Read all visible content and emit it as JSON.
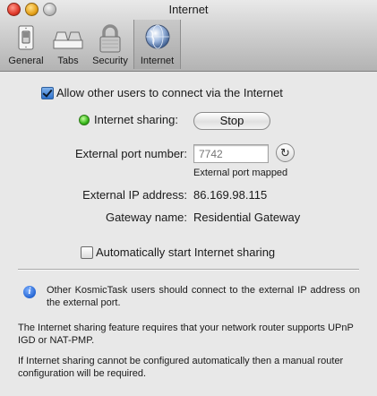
{
  "window": {
    "title": "Internet"
  },
  "toolbar": {
    "items": [
      {
        "label": "General",
        "icon": "light-switch-icon",
        "selected": false
      },
      {
        "label": "Tabs",
        "icon": "tabs-icon",
        "selected": false
      },
      {
        "label": "Security",
        "icon": "padlock-icon",
        "selected": false
      },
      {
        "label": "Internet",
        "icon": "globe-icon",
        "selected": true
      }
    ]
  },
  "settings": {
    "allow_checkbox": {
      "label": "Allow other users to connect via the Internet",
      "checked": true
    },
    "sharing": {
      "label": "Internet sharing:",
      "status_color": "#36b81a",
      "button_label": "Stop"
    },
    "port": {
      "label": "External port number:",
      "placeholder": "7742",
      "status": "External port mapped"
    },
    "ip": {
      "label": "External IP address:",
      "value": "86.169.98.115"
    },
    "gateway": {
      "label": "Gateway name:",
      "value": "Residential Gateway"
    },
    "auto_checkbox": {
      "label": "Automatically start Internet sharing",
      "checked": false
    }
  },
  "info": {
    "note": "Other KosmicTask users should connect to the external IP address on the external port.",
    "requirements": "The Internet sharing feature requires that your network router supports UPnP IGD or NAT-PMP.",
    "fallback": "If Internet sharing cannot be configured automatically then a manual router configuration will be required."
  },
  "colors": {
    "accent": "#2f73cf",
    "chrome_bottom": "#b3b3b3",
    "background": "#e8e8e8"
  }
}
